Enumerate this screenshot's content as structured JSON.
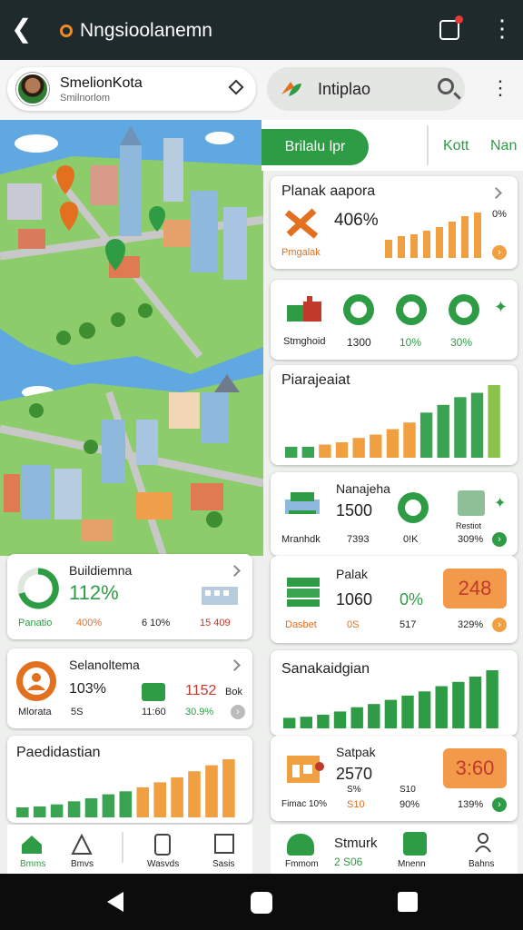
{
  "topbar": {
    "title": "Nngsioolanemn"
  },
  "user": {
    "name": "SmelionKota",
    "subtitle": "Smilnorlom"
  },
  "search": {
    "text": "Intiplao"
  },
  "tabs": [
    "Brilalu lpr",
    "Kott",
    "Nan"
  ],
  "card_planak": {
    "title": "Planak aapora",
    "value": "406%",
    "label": "Pmgalak",
    "pct": "0%"
  },
  "card_icons": {
    "label": "Stmghoid",
    "v1": "1300",
    "v2": "10%",
    "v3": "30%"
  },
  "card_piarajeaiat": {
    "title": "Piarajeaiat"
  },
  "card_nanajeha": {
    "title": "Nanajeha",
    "value": "1500",
    "label": "Mranhdk",
    "v1": "7393",
    "v2": "0!K",
    "side": "Restiot",
    "pct": "309%"
  },
  "card_palak": {
    "title": "Palak",
    "value": "1060",
    "pct": "0%",
    "highlight": "248",
    "label": "Dasbet",
    "v1": "0S",
    "v2": "517",
    "pct2": "329%"
  },
  "card_sanak": {
    "title": "Sanakaidgian"
  },
  "card_satpak": {
    "title": "Satpak",
    "value": "2570",
    "highlight": "3:60",
    "sub1": "S%",
    "sub2": "S10",
    "label": "Fimac 10%",
    "v1": "S10",
    "v2": "90%",
    "pct": "139%"
  },
  "card_buildiemna": {
    "title": "Buildiemna",
    "value": "112%",
    "label": "Panatio",
    "v1": "400%",
    "v2": "6 10%",
    "v3": "15 409"
  },
  "card_selano": {
    "title": "Selanoltema",
    "value": "103%",
    "label": "Mlorata",
    "sub": "5S",
    "v1": "11:60",
    "num": "1152",
    "bok": "Bok",
    "pct": "30.9%"
  },
  "card_paedi": {
    "title": "Paedidastian"
  },
  "left_nav": [
    "Bmms",
    "Bmvs",
    "Wasvds",
    "Sasis"
  ],
  "right_nav": {
    "items": [
      "Fmmom",
      "Mnenn",
      "Bahns"
    ],
    "title": "Stmurk",
    "value": "2 S06"
  },
  "colors": {
    "green": "#2e9b45",
    "orange": "#f0a040",
    "dark": "#1f2a2c"
  },
  "chart_data": [
    {
      "type": "bar",
      "title": "Piarajeaiat",
      "values": [
        1,
        1,
        1.2,
        1.4,
        1.8,
        2.1,
        2.6,
        3.2,
        4.1,
        4.8,
        5.5,
        5.9,
        6.6
      ]
    },
    {
      "type": "bar",
      "title": "Sanakaidgian",
      "values": [
        1,
        1.1,
        1.3,
        1.6,
        2,
        2.3,
        2.7,
        3.1,
        3.5,
        4,
        4.4,
        4.9,
        5.5
      ]
    },
    {
      "type": "bar",
      "title": "Paedidastian",
      "values": [
        1,
        1.1,
        1.3,
        1.6,
        1.9,
        2.3,
        2.6,
        3,
        3.5,
        4,
        4.6,
        5.2,
        5.8
      ]
    }
  ]
}
